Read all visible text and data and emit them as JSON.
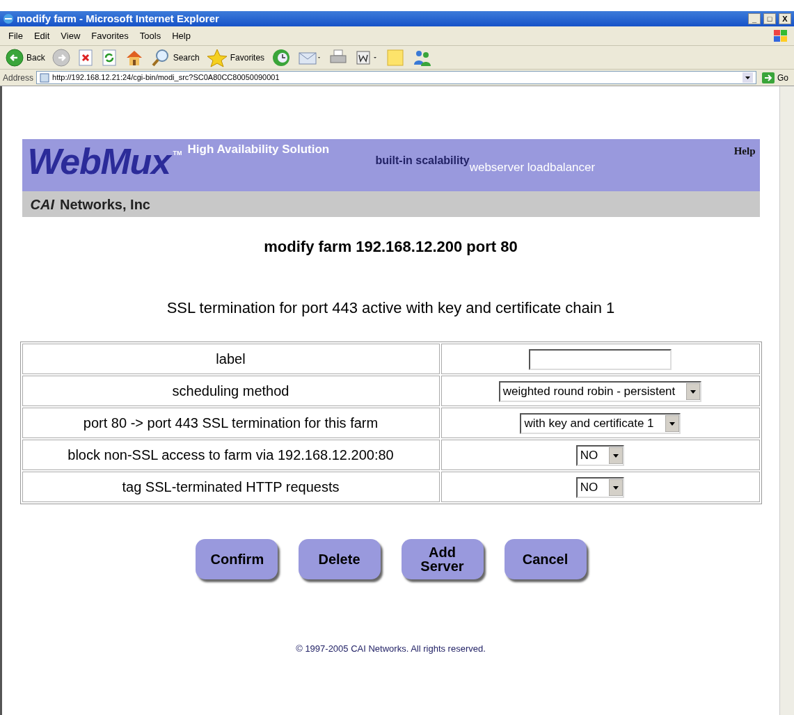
{
  "window": {
    "title": "modify farm - Microsoft Internet Explorer",
    "controls": [
      "_",
      "□",
      "X"
    ]
  },
  "menu": [
    "File",
    "Edit",
    "View",
    "Favorites",
    "Tools",
    "Help"
  ],
  "toolbar": [
    {
      "kind": "back",
      "label": "Back"
    },
    {
      "kind": "forward"
    },
    {
      "kind": "stop"
    },
    {
      "kind": "refresh"
    },
    {
      "kind": "home"
    },
    {
      "kind": "search",
      "label": "Search"
    },
    {
      "kind": "favorites",
      "label": "Favorites"
    },
    {
      "kind": "history"
    },
    {
      "kind": "mail"
    },
    {
      "kind": "print"
    },
    {
      "kind": "word"
    },
    {
      "kind": "note"
    },
    {
      "kind": "messenger"
    }
  ],
  "address": {
    "label": "Address",
    "value": "http://192.168.12.21:24/cgi-bin/modi_src?SC0A80CC80050090001",
    "go": "Go"
  },
  "banner": {
    "logo": "WebMux",
    "tm": "TM",
    "tagline": "High Availability Solution",
    "slogan": "built-in scalability",
    "product": "webserver loadbalancer",
    "help": "Help",
    "company_mark": "CAI",
    "company": "Networks, Inc"
  },
  "heading": "modify farm 192.168.12.200 port 80",
  "subheading": "SSL termination for port 443 active with key and certificate chain 1",
  "rows": [
    {
      "label": "label",
      "kind": "text",
      "value": ""
    },
    {
      "label": "scheduling method",
      "kind": "select",
      "value": "weighted round robin - persistent"
    },
    {
      "label": "port 80 -> port 443 SSL termination for this farm",
      "kind": "select",
      "value": "with key and certificate 1"
    },
    {
      "label": "block non-SSL access to farm via 192.168.12.200:80",
      "kind": "select",
      "value": "NO"
    },
    {
      "label": "tag SSL-terminated HTTP requests",
      "kind": "select",
      "value": "NO"
    }
  ],
  "buttons": [
    "Confirm",
    "Delete",
    "Add Server",
    "Cancel"
  ],
  "footer": "© 1997-2005 CAI Networks. All rights reserved."
}
